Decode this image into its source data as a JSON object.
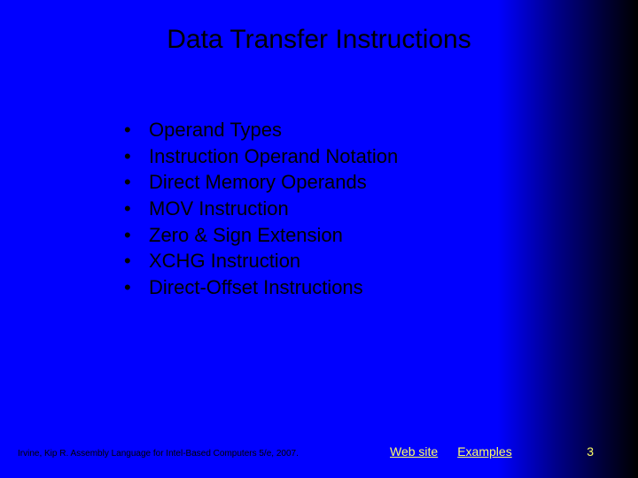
{
  "title": "Data Transfer Instructions",
  "bullets": [
    "Operand Types",
    "Instruction Operand Notation",
    "Direct Memory Operands",
    "MOV Instruction",
    "Zero & Sign Extension",
    "XCHG Instruction",
    "Direct-Offset Instructions"
  ],
  "footer": {
    "author": "Irvine, Kip R. Assembly Language for Intel-Based Computers 5/e, 2007.",
    "link_web": "Web site",
    "link_examples": "Examples"
  },
  "page_number": "3"
}
